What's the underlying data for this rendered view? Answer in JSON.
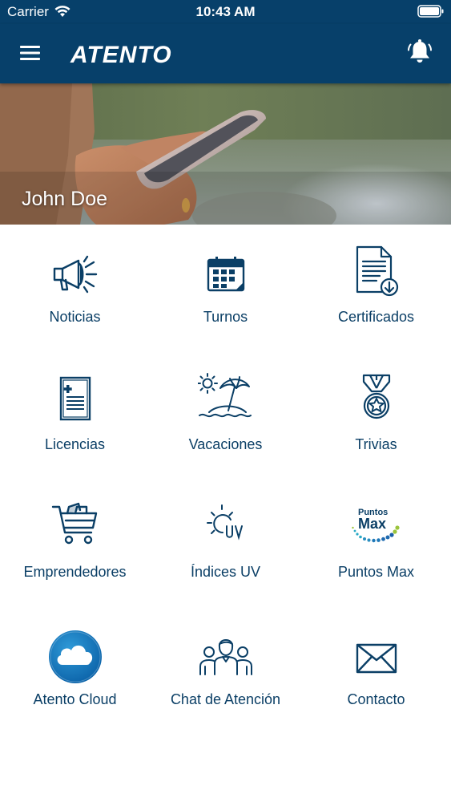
{
  "status_bar": {
    "carrier": "Carrier",
    "time": "10:43 AM",
    "wifi_icon": "wifi-icon",
    "battery_icon": "battery-icon"
  },
  "nav_bar": {
    "menu_icon": "hamburger-menu-icon",
    "logo_text": "ATENTO",
    "notification_icon": "bell-icon",
    "background_color": "#07406a"
  },
  "hero": {
    "user_name": "John Doe"
  },
  "menu": {
    "items": [
      {
        "label": "Noticias",
        "icon": "megaphone-icon"
      },
      {
        "label": "Turnos",
        "icon": "calendar-icon"
      },
      {
        "label": "Certificados",
        "icon": "certificate-download-icon"
      },
      {
        "label": "Licencias",
        "icon": "medical-document-icon"
      },
      {
        "label": "Vacaciones",
        "icon": "beach-umbrella-icon"
      },
      {
        "label": "Trivias",
        "icon": "medal-icon"
      },
      {
        "label": "Emprendedores",
        "icon": "shopping-cart-icon"
      },
      {
        "label": "Índices UV",
        "icon": "sun-uv-icon"
      },
      {
        "label": "Puntos Max",
        "icon": "puntos-max-logo"
      },
      {
        "label": "Atento Cloud",
        "icon": "cloud-icon"
      },
      {
        "label": "Chat de Atención",
        "icon": "people-group-icon"
      },
      {
        "label": "Contacto",
        "icon": "envelope-icon"
      }
    ],
    "label_color": "#0b3f66",
    "icon_color": "#0b3f66"
  },
  "puntos_max_logo": {
    "top": "Puntos",
    "bottom": "Max"
  }
}
